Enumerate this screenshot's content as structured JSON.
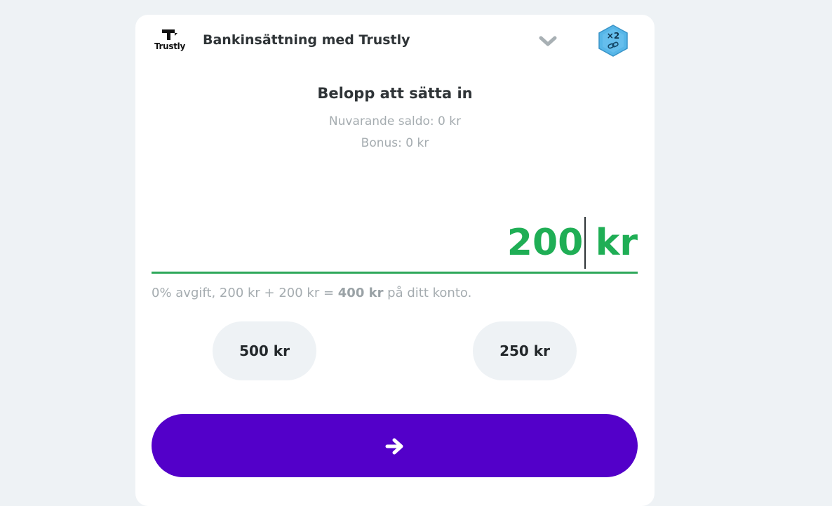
{
  "header": {
    "logo_text": "Trustly",
    "method_title": "Bankinsättning med Trustly",
    "bonus_badge": "×2"
  },
  "deposit": {
    "heading": "Belopp att sätta in",
    "balance": "Nuvarande saldo: 0 kr",
    "bonus": "Bonus: 0 kr",
    "amount_value": "200",
    "currency": "kr",
    "fee_prefix": "0% avgift, 200 kr + 200 kr = ",
    "fee_total": "400 kr",
    "fee_suffix": " på ditt konto."
  },
  "presets": [
    {
      "label": "500 kr"
    },
    {
      "label": "250 kr"
    }
  ],
  "submit": {
    "icon": "arrow-right-icon"
  },
  "colors": {
    "accent_green": "#1fae55",
    "primary_purple": "#5300c9",
    "muted_text": "#a5acb0",
    "background": "#eef2f5",
    "badge_blue": "#4fb3e6"
  }
}
